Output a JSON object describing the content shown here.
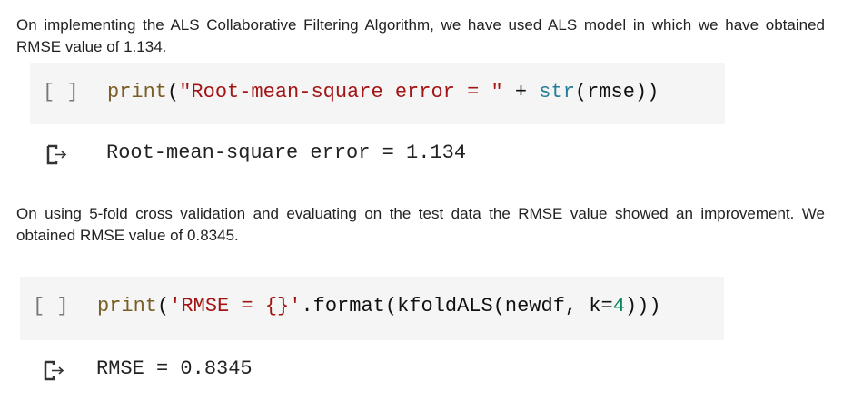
{
  "paragraph1": "On implementing the ALS Collaborative Filtering Algorithm, we have used ALS model in which we have obtained RMSE value of 1.134.",
  "cell1": {
    "run_indicator": "[ ]",
    "tokens": {
      "t0": "print",
      "t1": "(",
      "t2": "\"Root-mean-square error = \"",
      "t3": " + ",
      "t4": "str",
      "t5": "(rmse))"
    },
    "output": "Root-mean-square error = 1.134",
    "output_icon": "output-arrow-icon"
  },
  "paragraph2": "On using 5-fold cross validation and evaluating on the test data the RMSE value showed an improvement. We obtained RMSE value of 0.8345.",
  "cell2": {
    "run_indicator": "[ ]",
    "tokens": {
      "t0": "print",
      "t1": "(",
      "t2": "'RMSE = {}'",
      "t3": ".format(kfoldALS(newdf, k=",
      "t4": "4",
      "t5": ")))"
    },
    "output": "RMSE = 0.8345",
    "output_icon": "output-arrow-icon"
  },
  "colors": {
    "function": "#795e26",
    "string": "#a31515",
    "builtin": "#267f99",
    "number": "#098658",
    "cell_bg": "#f5f5f5"
  }
}
